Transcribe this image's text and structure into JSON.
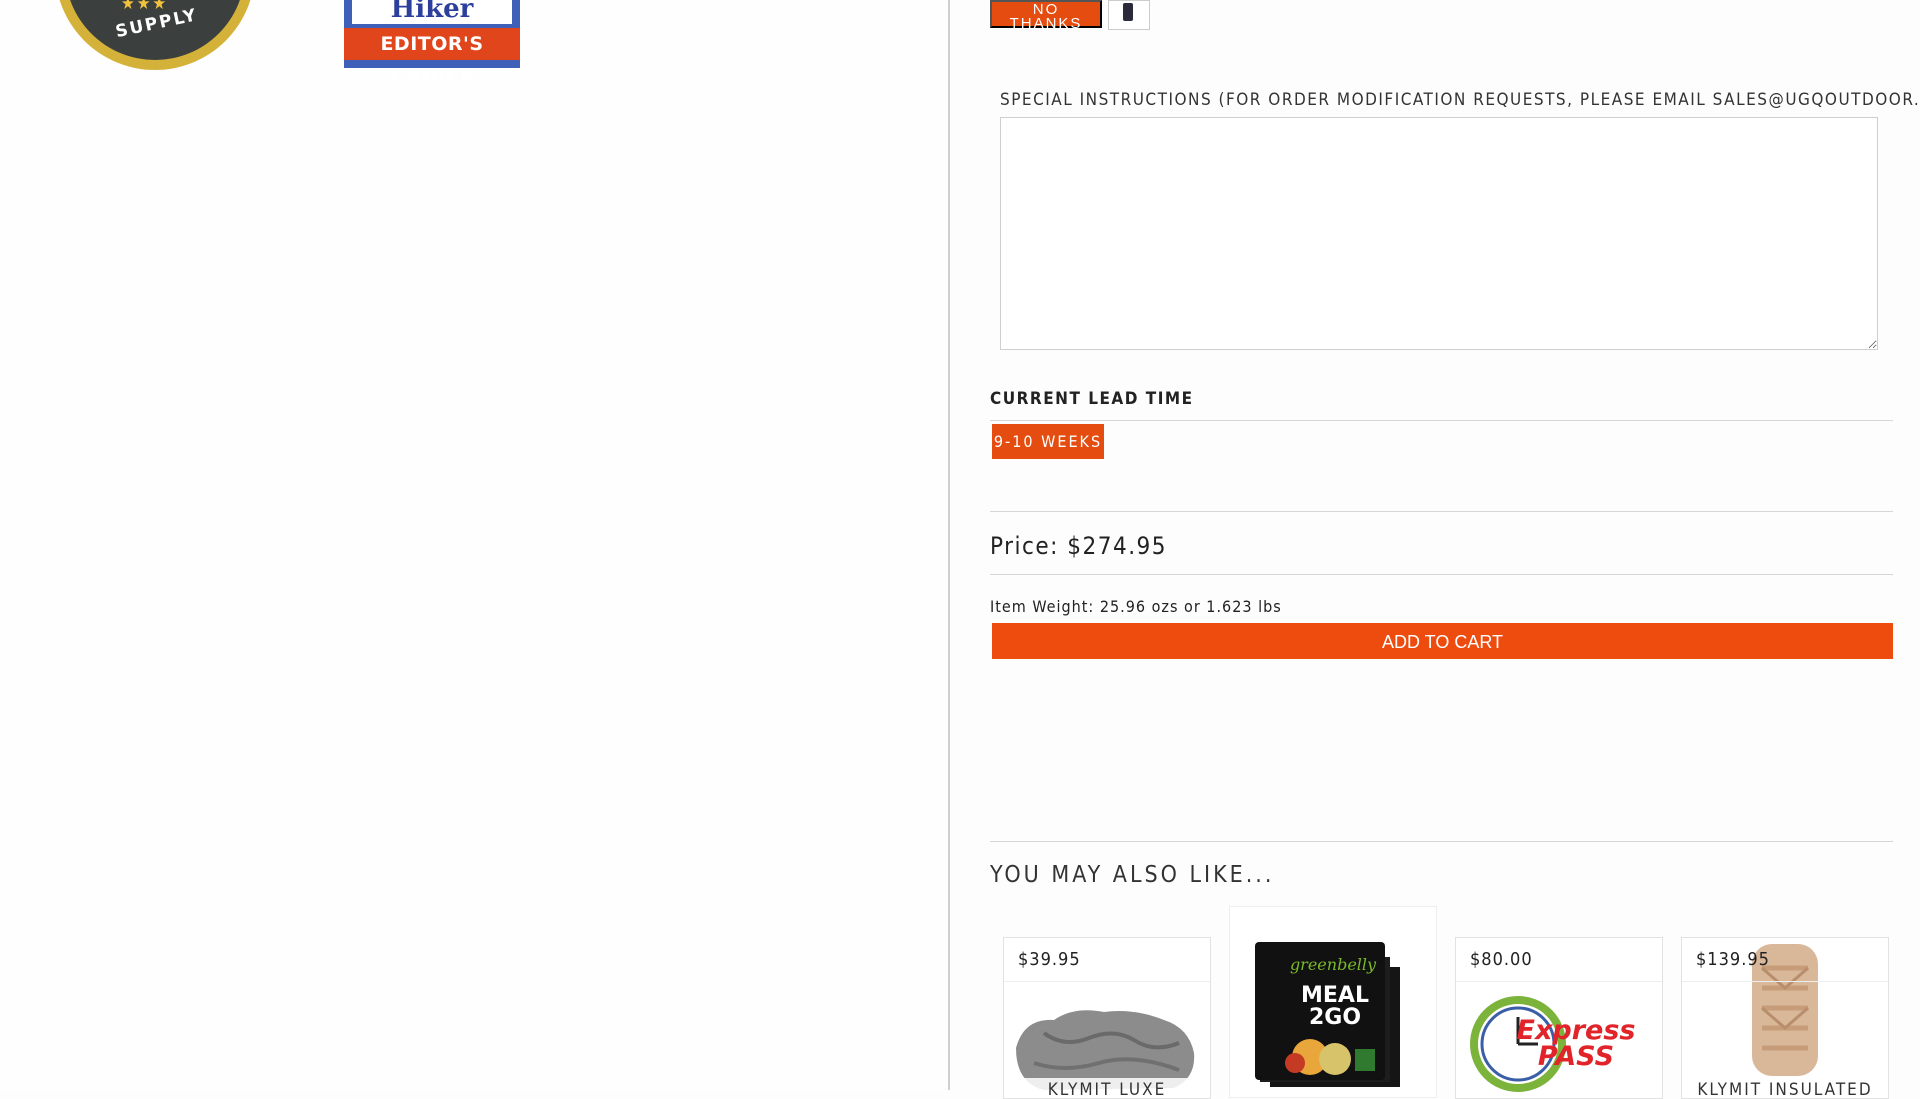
{
  "badges": {
    "supply_text": "SUPPLY",
    "supply_stars": "★★★",
    "hiker_text": "Hiker",
    "hiker_ribbon": "EDITOR'S CHOICE"
  },
  "addon": {
    "no_thanks_label": "NO THANKS"
  },
  "special_instructions": {
    "label": "SPECIAL INSTRUCTIONS (FOR ORDER MODIFICATION REQUESTS, PLEASE EMAIL SALES@UGQOUTDOOR.COM)",
    "value": ""
  },
  "lead_time": {
    "label": "CURRENT LEAD TIME",
    "value": "9-10 WEEKS"
  },
  "product": {
    "price": "Price: $274.95",
    "weight": "Item Weight: 25.96 ozs or 1.623 lbs",
    "add_to_cart_label": "ADD TO CART"
  },
  "related": {
    "heading": "YOU MAY ALSO LIKE...",
    "items": [
      {
        "price": "$39.95",
        "name": "KLYMIT LUXE",
        "image_icon": "pillow-icon"
      },
      {
        "price": "",
        "name": "",
        "image_icon": "meal-pack-icon",
        "image_text": "MEAL 2GO",
        "brand_text": "greenbelly"
      },
      {
        "price": "$80.00",
        "name": "",
        "image_icon": "express-pass-icon",
        "image_text": "Express PASS"
      },
      {
        "price": "$139.95",
        "name": "KLYMIT INSULATED",
        "image_icon": "sleeping-pad-icon"
      }
    ]
  },
  "colors": {
    "accent": "#EE4B0E",
    "divider": "#CFCFCF"
  }
}
